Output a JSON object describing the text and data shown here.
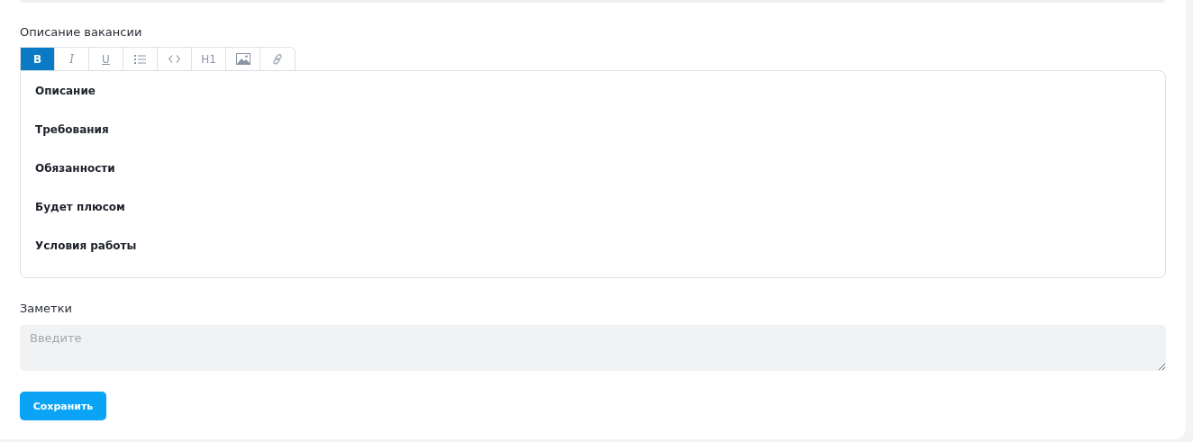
{
  "description": {
    "label": "Описание вакансии",
    "toolbar": [
      {
        "kind": "bold",
        "label": "B",
        "selected": true
      },
      {
        "kind": "italic",
        "label": "I",
        "selected": false
      },
      {
        "kind": "underline",
        "label": "U",
        "selected": false
      },
      {
        "kind": "list",
        "selected": false
      },
      {
        "kind": "code",
        "selected": false
      },
      {
        "kind": "heading",
        "label": "H1",
        "selected": false
      },
      {
        "kind": "image",
        "selected": false
      },
      {
        "kind": "link",
        "selected": false
      }
    ],
    "content": [
      "Описание",
      "Требования",
      "Обязанности",
      "Будет плюсом",
      "Условия работы"
    ]
  },
  "notes": {
    "label": "Заметки",
    "placeholder": "Введите"
  },
  "save_button": "Сохранить"
}
